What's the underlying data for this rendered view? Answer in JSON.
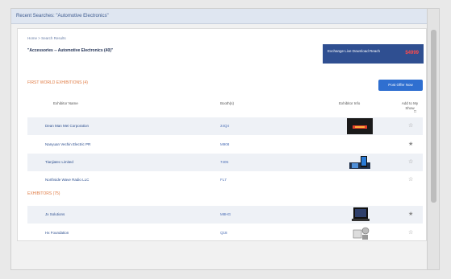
{
  "search_bar": {
    "text": "Recent Searches: \"Automotive Electronics\""
  },
  "breadcrumb": "Home > Search Results",
  "category_title": "\"Accessories -- Automotive Electronics (40)\"",
  "banner": {
    "text": "Exchange Live Download Reach",
    "price": "$4999"
  },
  "section1": {
    "heading": "FIRST WORLD EXHIBITIONS (4)"
  },
  "post_button": "Post Offer Now",
  "columns": {
    "exhibitor": "Exhibitor Name",
    "booth": "Booth(s)",
    "exhibitor_info": "Exhibitor Info",
    "add": "Add to My Show"
  },
  "rows_section1": [
    {
      "name": "Dean Man Mei Corporation",
      "code": "24Q4",
      "thumb": "fireplace"
    },
    {
      "name": "Nanyuan Vechin Electric PR",
      "code": "M908",
      "thumb": ""
    },
    {
      "name": "Tianjiatec Limited",
      "code": "7405",
      "thumb": "devices"
    },
    {
      "name": "Northside Wave Radio LLC",
      "code": "FL7",
      "thumb": ""
    }
  ],
  "section2": {
    "heading": "EXHIBITORS (75)"
  },
  "rows_section2": [
    {
      "name": "Jx Solutions",
      "code": "M8HG",
      "thumb": "laptop"
    },
    {
      "name": "Hx Foundation",
      "code": "Q18",
      "thumb": "gadgets"
    }
  ]
}
